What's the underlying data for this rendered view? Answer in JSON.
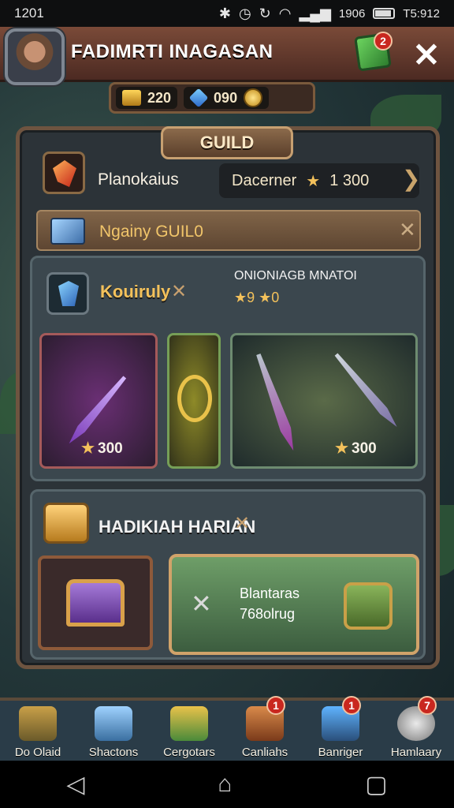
{
  "status": {
    "time": "1201",
    "right_text": "1906",
    "clock": "T5:912"
  },
  "header": {
    "title": "FADIMRTI INAGASAN",
    "badge": "2",
    "close_label": "✕"
  },
  "currency": {
    "gold": "220",
    "gems": "090"
  },
  "guild": {
    "tab_label": "GUILD",
    "member_name": "Planokaius",
    "role_label": "Dacerner",
    "role_value": "1 300",
    "guild_name": "Ngainy GUIL0",
    "section_title": "Kouiruly",
    "section_subtitle": "ONIONIAGB MNATOI",
    "section_values": [
      "9",
      "0"
    ],
    "item_prices": [
      "300",
      "300"
    ]
  },
  "daily": {
    "title": "HADIKIAH HARIAN",
    "card_line1": "Blantaras",
    "card_line2": "768olrug"
  },
  "nav": [
    {
      "label": "Do Olaid",
      "badge": "",
      "color": "#9a7a2a"
    },
    {
      "label": "Shactons",
      "badge": "",
      "color": "#4a8fcf"
    },
    {
      "label": "Cergotars",
      "badge": "",
      "color": "#c09a3a"
    },
    {
      "label": "Canliahs",
      "badge": "1",
      "color": "#b0602a"
    },
    {
      "label": "Banriger",
      "badge": "1",
      "color": "#3a6fa0"
    },
    {
      "label": "Hamlaary",
      "badge": "7",
      "color": "#9a9a9a"
    }
  ]
}
